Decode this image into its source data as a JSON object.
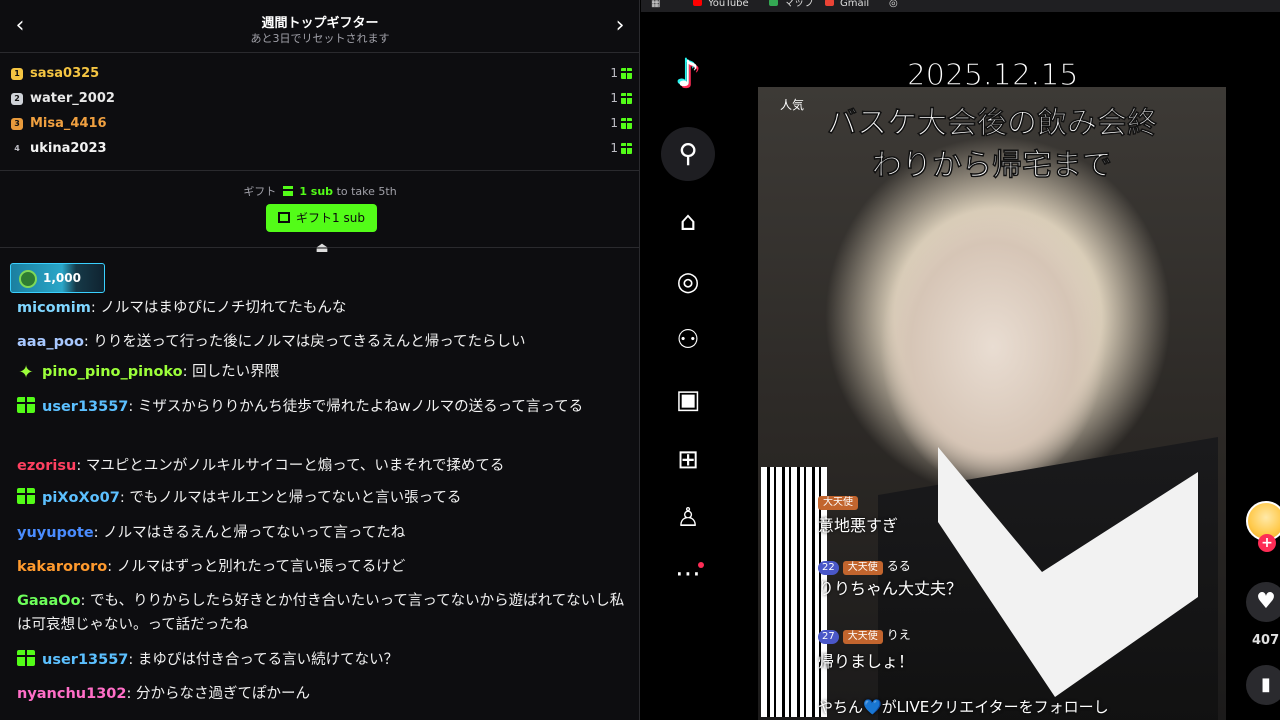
{
  "gifter": {
    "title": "週間トップギフター",
    "subtitle": "あと3日でリセットされます",
    "prev": "‹",
    "next": "›",
    "rows": [
      {
        "rank": "1",
        "name": "sasa0325",
        "count": "1",
        "color": "#f5c542"
      },
      {
        "rank": "2",
        "name": "water_2002",
        "count": "1",
        "color": "#e8e8e8"
      },
      {
        "rank": "3",
        "name": "Misa_4416",
        "count": "1",
        "color": "#f0a040"
      },
      {
        "rank": "4",
        "name": "ukina2023",
        "count": "1",
        "color": "#f2f2f2"
      }
    ]
  },
  "gift_cta": {
    "hint_prefix": "ギフト",
    "hint_highlight": "1 sub",
    "hint_suffix": "to take 5th",
    "button_label": "ギフト1 sub"
  },
  "coin": {
    "value": "1,000"
  },
  "chat": [
    {
      "user": "micomim",
      "color": "#7fd6ff",
      "badge": "",
      "text": "ノルマはまゆぴにノチ切れてたもんな"
    },
    {
      "user": "aaa_poo",
      "color": "#a8c8ff",
      "badge": "",
      "text": "りりを送って行った後にノルマは戻ってきるえんと帰ってたらしい"
    },
    {
      "user": "pino_pino_pinoko",
      "color": "#9cff3a",
      "badge": "star",
      "text": "回したい界隈"
    },
    {
      "user": "user13557",
      "color": "#5cc0ff",
      "badge": "gift",
      "text": "ミザスからりりかんち徒歩で帰れたよねwノルマの送るって言ってる"
    },
    {
      "user": "ezorisu",
      "color": "#ff4060",
      "badge": "",
      "text": "マユピとユンがノルキルサイコーと煽って、いまそれで揉めてる"
    },
    {
      "user": "piXoXo07",
      "color": "#5cc0ff",
      "badge": "gift",
      "text": "でもノルマはキルエンと帰ってないと言い張ってる"
    },
    {
      "user": "yuyupote",
      "color": "#4a8cff",
      "badge": "",
      "text": "ノルマはきるえんと帰ってないって言ってたね"
    },
    {
      "user": "kakarororo",
      "color": "#ff9a2e",
      "badge": "",
      "text": "ノルマはずっと別れたって言い張ってるけど"
    },
    {
      "user": "GaaaOo",
      "color": "#6dff5a",
      "badge": "",
      "text": "でも、りりからしたら好きとか付き合いたいって言ってないから遊ばれてないし私は可哀想じゃない。って話だったね"
    },
    {
      "user": "user13557",
      "color": "#5cc0ff",
      "badge": "gift",
      "text": "まゆぴは付き合ってる言い続けてない？"
    },
    {
      "user": "nyanchu1302",
      "color": "#ff6ec7",
      "badge": "",
      "text": "分からなさ過ぎてぽかーん"
    }
  ],
  "browser": {
    "bookmarks": [
      {
        "label": "YouTube",
        "color": "#ff0000"
      },
      {
        "label": "マップ",
        "color": "#34a853"
      },
      {
        "label": "Gmail",
        "color": "#ea4335"
      }
    ]
  },
  "tiktok": {
    "logo": "♪",
    "sidebar_icons": [
      "search-icon",
      "home-icon",
      "explore-icon",
      "following-icon",
      "live-icon",
      "upload-icon",
      "profile-icon",
      "more-icon"
    ],
    "video": {
      "date": "2025.12.15",
      "caption_line1": "バスケ大会後の飲み会終",
      "caption_line2": "わりから帰宅まで",
      "live_header": "人気",
      "comments": [
        {
          "level": "",
          "tag": "大天使",
          "name": "",
          "text": "意地悪すぎ"
        },
        {
          "level": "22",
          "tag": "大天使",
          "name": "るる",
          "text": "りりちゃん大丈夫？"
        },
        {
          "level": "27",
          "tag": "大天使",
          "name": "りえ",
          "text": "帰りましょ！"
        }
      ],
      "follow_notice": "やちん💙がLIVEクリエイターをフォローし"
    },
    "like_count": "407",
    "colors": {
      "accent": "#fe2c55",
      "cyan": "#25f4ee",
      "kick_green": "#53fc18"
    }
  }
}
